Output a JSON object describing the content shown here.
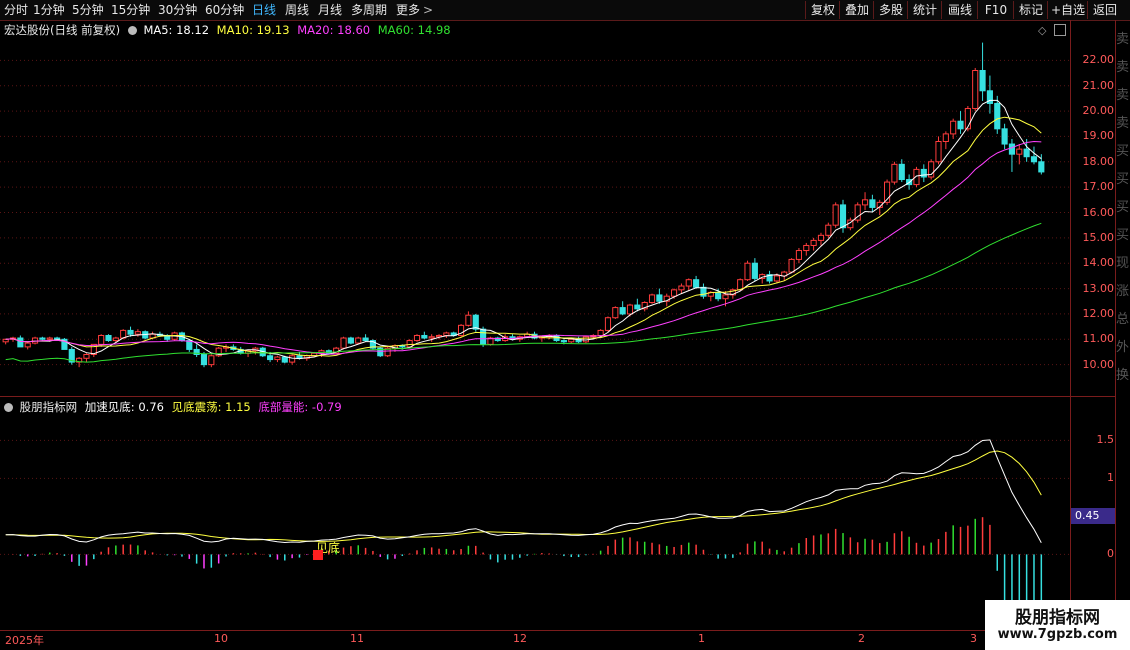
{
  "toolbar": {
    "tabs": [
      {
        "label": "分时"
      },
      {
        "label": "1分钟"
      },
      {
        "label": "5分钟"
      },
      {
        "label": "15分钟"
      },
      {
        "label": "30分钟"
      },
      {
        "label": "60分钟"
      },
      {
        "label": "日线"
      },
      {
        "label": "周线"
      },
      {
        "label": "月线"
      },
      {
        "label": "多周期"
      },
      {
        "label": "更多"
      }
    ],
    "more_arrow": ">",
    "right_buttons": [
      {
        "label": "复权"
      },
      {
        "label": "叠加"
      },
      {
        "label": "多股"
      },
      {
        "label": "统计"
      },
      {
        "label": "画线"
      },
      {
        "label": "F10"
      },
      {
        "label": "标记"
      },
      {
        "label": "+自选"
      },
      {
        "label": "返回"
      }
    ]
  },
  "main_chart": {
    "title": "宏达股份(日线 前复权)",
    "ma": [
      {
        "label": "MA5: 18.12",
        "color": "#ffffff"
      },
      {
        "label": "MA10: 19.13",
        "color": "#ffff40"
      },
      {
        "label": "MA20: 18.60",
        "color": "#ff40ff"
      },
      {
        "label": "MA60: 14.98",
        "color": "#30e030"
      }
    ],
    "y_ticks": [
      "22.00",
      "21.00",
      "20.00",
      "19.00",
      "18.00",
      "17.00",
      "16.00",
      "15.00",
      "14.00",
      "13.00",
      "12.00",
      "11.00",
      "10.00"
    ]
  },
  "indicator": {
    "name": "股朋指标网",
    "values": [
      {
        "label": "加速见底: 0.76",
        "color": "#ffffff"
      },
      {
        "label": "见底震荡: 1.15",
        "color": "#ffff40"
      },
      {
        "label": "底部量能: -0.79",
        "color": "#ff40ff"
      }
    ],
    "y_ticks": [
      "1.50",
      "1.00",
      "0.00"
    ],
    "current_value": "0.45",
    "signal_label": "见底"
  },
  "x_axis": {
    "labels": [
      "2025年",
      "10",
      "11",
      "12",
      "1",
      "2",
      "3"
    ]
  },
  "watermark": {
    "title": "股朋指标网",
    "url": "www.7gpzb.com"
  },
  "chart_data": {
    "type": "candlestick",
    "title": "宏达股份(日线 前复权)",
    "ylim": [
      9.0,
      23.0
    ],
    "x_labels": [
      "2025年",
      "10",
      "11",
      "12",
      "1",
      "2",
      "3"
    ],
    "candles": [
      [
        10.9,
        11.0,
        10.8,
        11.0
      ],
      [
        11.0,
        11.1,
        10.9,
        11.05
      ],
      [
        11.05,
        11.15,
        10.7,
        10.7
      ],
      [
        10.7,
        10.9,
        10.6,
        10.85
      ],
      [
        10.85,
        11.1,
        10.8,
        11.05
      ],
      [
        11.05,
        11.1,
        10.95,
        11.0
      ],
      [
        11.0,
        11.1,
        10.9,
        11.05
      ],
      [
        11.05,
        11.1,
        10.95,
        11.0
      ],
      [
        11.0,
        11.05,
        10.6,
        10.6
      ],
      [
        10.6,
        10.7,
        10.0,
        10.1
      ],
      [
        10.1,
        10.3,
        9.9,
        10.25
      ],
      [
        10.25,
        10.45,
        10.1,
        10.4
      ],
      [
        10.4,
        10.8,
        10.3,
        10.8
      ],
      [
        10.8,
        11.2,
        10.7,
        11.15
      ],
      [
        11.15,
        11.2,
        10.9,
        10.95
      ],
      [
        10.95,
        11.1,
        10.85,
        11.05
      ],
      [
        11.05,
        11.4,
        11.0,
        11.35
      ],
      [
        11.35,
        11.5,
        11.1,
        11.2
      ],
      [
        11.2,
        11.4,
        11.1,
        11.3
      ],
      [
        11.3,
        11.35,
        11.0,
        11.05
      ],
      [
        11.05,
        11.3,
        11.0,
        11.2
      ],
      [
        11.2,
        11.3,
        11.1,
        11.15
      ],
      [
        11.15,
        11.2,
        10.9,
        11.0
      ],
      [
        11.0,
        11.3,
        10.95,
        11.25
      ],
      [
        11.25,
        11.3,
        10.9,
        10.95
      ],
      [
        10.95,
        11.0,
        10.5,
        10.6
      ],
      [
        10.6,
        10.8,
        10.3,
        10.4
      ],
      [
        10.4,
        10.5,
        9.9,
        10.0
      ],
      [
        10.0,
        10.4,
        9.9,
        10.35
      ],
      [
        10.35,
        10.7,
        10.3,
        10.65
      ],
      [
        10.65,
        10.8,
        10.5,
        10.7
      ],
      [
        10.7,
        10.8,
        10.55,
        10.6
      ],
      [
        10.6,
        10.7,
        10.4,
        10.45
      ],
      [
        10.45,
        10.6,
        10.3,
        10.55
      ],
      [
        10.55,
        10.7,
        10.4,
        10.65
      ],
      [
        10.65,
        10.7,
        10.3,
        10.35
      ],
      [
        10.35,
        10.5,
        10.1,
        10.2
      ],
      [
        10.2,
        10.35,
        10.1,
        10.3
      ],
      [
        10.3,
        10.35,
        10.05,
        10.1
      ],
      [
        10.1,
        10.4,
        10.0,
        10.35
      ],
      [
        10.35,
        10.5,
        10.2,
        10.25
      ],
      [
        10.25,
        10.4,
        10.15,
        10.35
      ],
      [
        10.35,
        10.5,
        10.3,
        10.45
      ],
      [
        10.45,
        10.6,
        10.3,
        10.55
      ],
      [
        10.55,
        10.6,
        10.4,
        10.45
      ],
      [
        10.45,
        10.7,
        10.4,
        10.65
      ],
      [
        10.65,
        11.1,
        10.6,
        11.05
      ],
      [
        11.05,
        11.1,
        10.8,
        10.85
      ],
      [
        10.85,
        11.1,
        10.8,
        11.05
      ],
      [
        11.05,
        11.2,
        10.9,
        10.95
      ],
      [
        10.95,
        11.0,
        10.6,
        10.65
      ],
      [
        10.65,
        10.7,
        10.3,
        10.35
      ],
      [
        10.35,
        10.7,
        10.3,
        10.65
      ],
      [
        10.65,
        10.8,
        10.5,
        10.75
      ],
      [
        10.75,
        10.8,
        10.6,
        10.7
      ],
      [
        10.7,
        11.0,
        10.65,
        10.95
      ],
      [
        10.95,
        11.2,
        10.9,
        11.15
      ],
      [
        11.15,
        11.3,
        11.0,
        11.05
      ],
      [
        11.05,
        11.2,
        10.9,
        11.1
      ],
      [
        11.1,
        11.2,
        11.0,
        11.15
      ],
      [
        11.15,
        11.3,
        11.05,
        11.25
      ],
      [
        11.25,
        11.3,
        11.1,
        11.15
      ],
      [
        11.15,
        11.6,
        11.1,
        11.55
      ],
      [
        11.55,
        12.1,
        11.5,
        11.95
      ],
      [
        11.95,
        12.0,
        11.3,
        11.4
      ],
      [
        11.4,
        11.5,
        10.7,
        10.8
      ],
      [
        10.8,
        11.1,
        10.75,
        11.05
      ],
      [
        11.05,
        11.1,
        10.9,
        10.95
      ],
      [
        10.95,
        11.2,
        10.9,
        11.1
      ],
      [
        11.1,
        11.2,
        10.95,
        11.0
      ],
      [
        11.0,
        11.15,
        10.9,
        11.1
      ],
      [
        11.1,
        11.3,
        11.05,
        11.2
      ],
      [
        11.2,
        11.3,
        11.0,
        11.05
      ],
      [
        11.05,
        11.15,
        10.9,
        11.1
      ],
      [
        11.1,
        11.2,
        11.0,
        11.15
      ],
      [
        11.15,
        11.2,
        10.9,
        10.95
      ],
      [
        10.95,
        11.0,
        10.8,
        10.9
      ],
      [
        10.9,
        11.05,
        10.85,
        11.0
      ],
      [
        11.0,
        11.1,
        10.85,
        10.9
      ],
      [
        10.9,
        11.15,
        10.85,
        11.1
      ],
      [
        11.1,
        11.2,
        11.0,
        11.15
      ],
      [
        11.15,
        11.4,
        11.1,
        11.35
      ],
      [
        11.35,
        11.9,
        11.3,
        11.85
      ],
      [
        11.85,
        12.3,
        11.8,
        12.25
      ],
      [
        12.25,
        12.5,
        11.95,
        12.0
      ],
      [
        12.0,
        12.4,
        11.9,
        12.35
      ],
      [
        12.35,
        12.6,
        12.1,
        12.2
      ],
      [
        12.2,
        12.5,
        12.1,
        12.45
      ],
      [
        12.45,
        12.8,
        12.4,
        12.75
      ],
      [
        12.75,
        13.0,
        12.4,
        12.5
      ],
      [
        12.5,
        12.8,
        12.3,
        12.7
      ],
      [
        12.7,
        13.0,
        12.6,
        12.95
      ],
      [
        12.95,
        13.2,
        12.8,
        13.1
      ],
      [
        13.1,
        13.4,
        12.9,
        13.35
      ],
      [
        13.35,
        13.5,
        13.0,
        13.05
      ],
      [
        13.05,
        13.2,
        12.6,
        12.7
      ],
      [
        12.7,
        12.9,
        12.5,
        12.85
      ],
      [
        12.85,
        13.0,
        12.5,
        12.6
      ],
      [
        12.6,
        12.9,
        12.3,
        12.75
      ],
      [
        12.75,
        13.0,
        12.6,
        12.95
      ],
      [
        12.95,
        13.4,
        12.9,
        13.35
      ],
      [
        13.35,
        14.1,
        13.3,
        14.0
      ],
      [
        14.0,
        14.2,
        13.3,
        13.4
      ],
      [
        13.4,
        13.6,
        13.2,
        13.55
      ],
      [
        13.55,
        13.7,
        13.2,
        13.3
      ],
      [
        13.3,
        13.6,
        13.2,
        13.5
      ],
      [
        13.5,
        13.7,
        13.3,
        13.65
      ],
      [
        13.65,
        14.2,
        13.6,
        14.15
      ],
      [
        14.15,
        14.6,
        14.0,
        14.5
      ],
      [
        14.5,
        14.8,
        14.3,
        14.7
      ],
      [
        14.7,
        15.0,
        14.5,
        14.9
      ],
      [
        14.9,
        15.2,
        14.7,
        15.1
      ],
      [
        15.1,
        15.6,
        15.0,
        15.5
      ],
      [
        15.5,
        16.4,
        15.4,
        16.3
      ],
      [
        16.3,
        16.5,
        15.2,
        15.4
      ],
      [
        15.4,
        15.8,
        15.3,
        15.7
      ],
      [
        15.7,
        16.4,
        15.6,
        16.3
      ],
      [
        16.3,
        16.8,
        16.1,
        16.5
      ],
      [
        16.5,
        16.7,
        16.0,
        16.2
      ],
      [
        16.2,
        16.5,
        15.9,
        16.4
      ],
      [
        16.4,
        17.3,
        16.3,
        17.2
      ],
      [
        17.2,
        18.0,
        17.1,
        17.9
      ],
      [
        17.9,
        18.1,
        17.2,
        17.3
      ],
      [
        17.3,
        17.5,
        16.9,
        17.1
      ],
      [
        17.1,
        17.8,
        17.0,
        17.7
      ],
      [
        17.7,
        17.9,
        17.2,
        17.4
      ],
      [
        17.4,
        18.1,
        17.3,
        18.0
      ],
      [
        18.0,
        19.0,
        17.9,
        18.8
      ],
      [
        18.8,
        19.2,
        18.5,
        19.1
      ],
      [
        19.1,
        19.7,
        18.9,
        19.6
      ],
      [
        19.6,
        20.0,
        19.1,
        19.3
      ],
      [
        19.3,
        20.2,
        19.2,
        20.1
      ],
      [
        20.1,
        21.7,
        20.0,
        21.6
      ],
      [
        21.6,
        22.7,
        20.4,
        20.8
      ],
      [
        20.8,
        21.4,
        19.9,
        20.3
      ],
      [
        20.3,
        20.6,
        19.1,
        19.3
      ],
      [
        19.3,
        19.5,
        18.5,
        18.7
      ],
      [
        18.7,
        18.9,
        17.6,
        18.3
      ],
      [
        18.3,
        18.7,
        17.9,
        18.5
      ],
      [
        18.5,
        18.9,
        18.0,
        18.2
      ],
      [
        18.2,
        18.6,
        17.9,
        18.0
      ],
      [
        18.0,
        18.3,
        17.5,
        17.6
      ]
    ],
    "series": [
      {
        "name": "MA5",
        "color": "#ffffff",
        "last": 18.12
      },
      {
        "name": "MA10",
        "color": "#ffff40",
        "last": 19.13
      },
      {
        "name": "MA20",
        "color": "#ff40ff",
        "last": 18.6
      },
      {
        "name": "MA60",
        "color": "#30e030",
        "last": 14.98
      }
    ],
    "indicator": {
      "ylim": [
        -0.6,
        1.9
      ],
      "y_ticks": [
        1.5,
        1.0,
        0.0
      ],
      "series": [
        {
          "name": "加速见底",
          "color": "#ffffff",
          "last": 0.76
        },
        {
          "name": "见底震荡",
          "color": "#ffff40",
          "last": 1.15
        },
        {
          "name": "底部量能",
          "color": "#ff40ff",
          "last": -0.79
        }
      ]
    }
  }
}
